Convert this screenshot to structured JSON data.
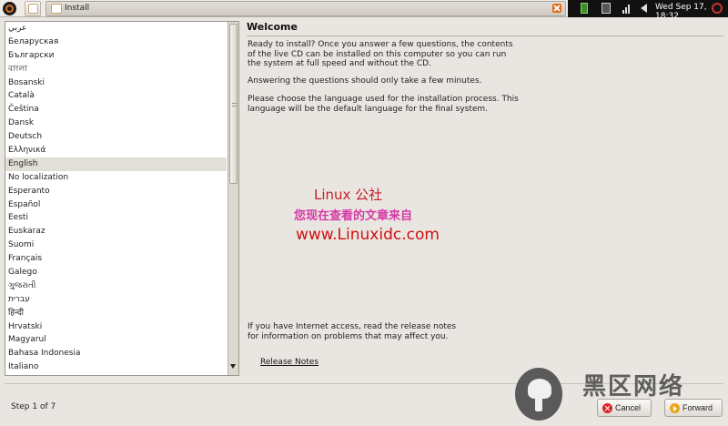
{
  "top_panel": {
    "window_title": "Install",
    "clock": "Wed Sep 17, 18:32"
  },
  "languages": [
    "عربي",
    "Беларуская",
    "Български",
    "বাংলা",
    "Bosanski",
    "Català",
    "Čeština",
    "Dansk",
    "Deutsch",
    "Ελληνικά",
    "English",
    "No localization",
    "Esperanto",
    "Español",
    "Eesti",
    "Euskaraz",
    "Suomi",
    "Français",
    "Galego",
    "ગુજરાતી",
    "עברית",
    "हिन्दी",
    "Hrvatski",
    "Magyarul",
    "Bahasa Indonesia",
    "Italiano"
  ],
  "selected_language": "English",
  "main": {
    "title": "Welcome",
    "paragraph1": "Ready to install? Once you answer a few questions, the contents of the live CD can be installed on this computer so you can run the system at full speed and without the CD.",
    "paragraph2": "Answering the questions should only take a few minutes.",
    "paragraph3": "Please choose the language used for the installation process. This language will be the default language for the final system.",
    "paragraph4": "If you have Internet access, read the release notes for information on problems that may affect you.",
    "release_notes_link": "Release Notes"
  },
  "watermark": {
    "title": "Linux 公社",
    "subtitle": "您现在查看的文章来自",
    "url": "www.Linuxidc.com"
  },
  "footer": {
    "step_label": "Step 1 of 7",
    "cancel_label": "Cancel",
    "forward_label": "Forward"
  },
  "corner_brand": "黑区网络",
  "colors": {
    "accent_orange": "#e07020",
    "selection": "#e2ded8",
    "watermark_red": "#d01010",
    "watermark_magenta": "#d63aa5"
  }
}
